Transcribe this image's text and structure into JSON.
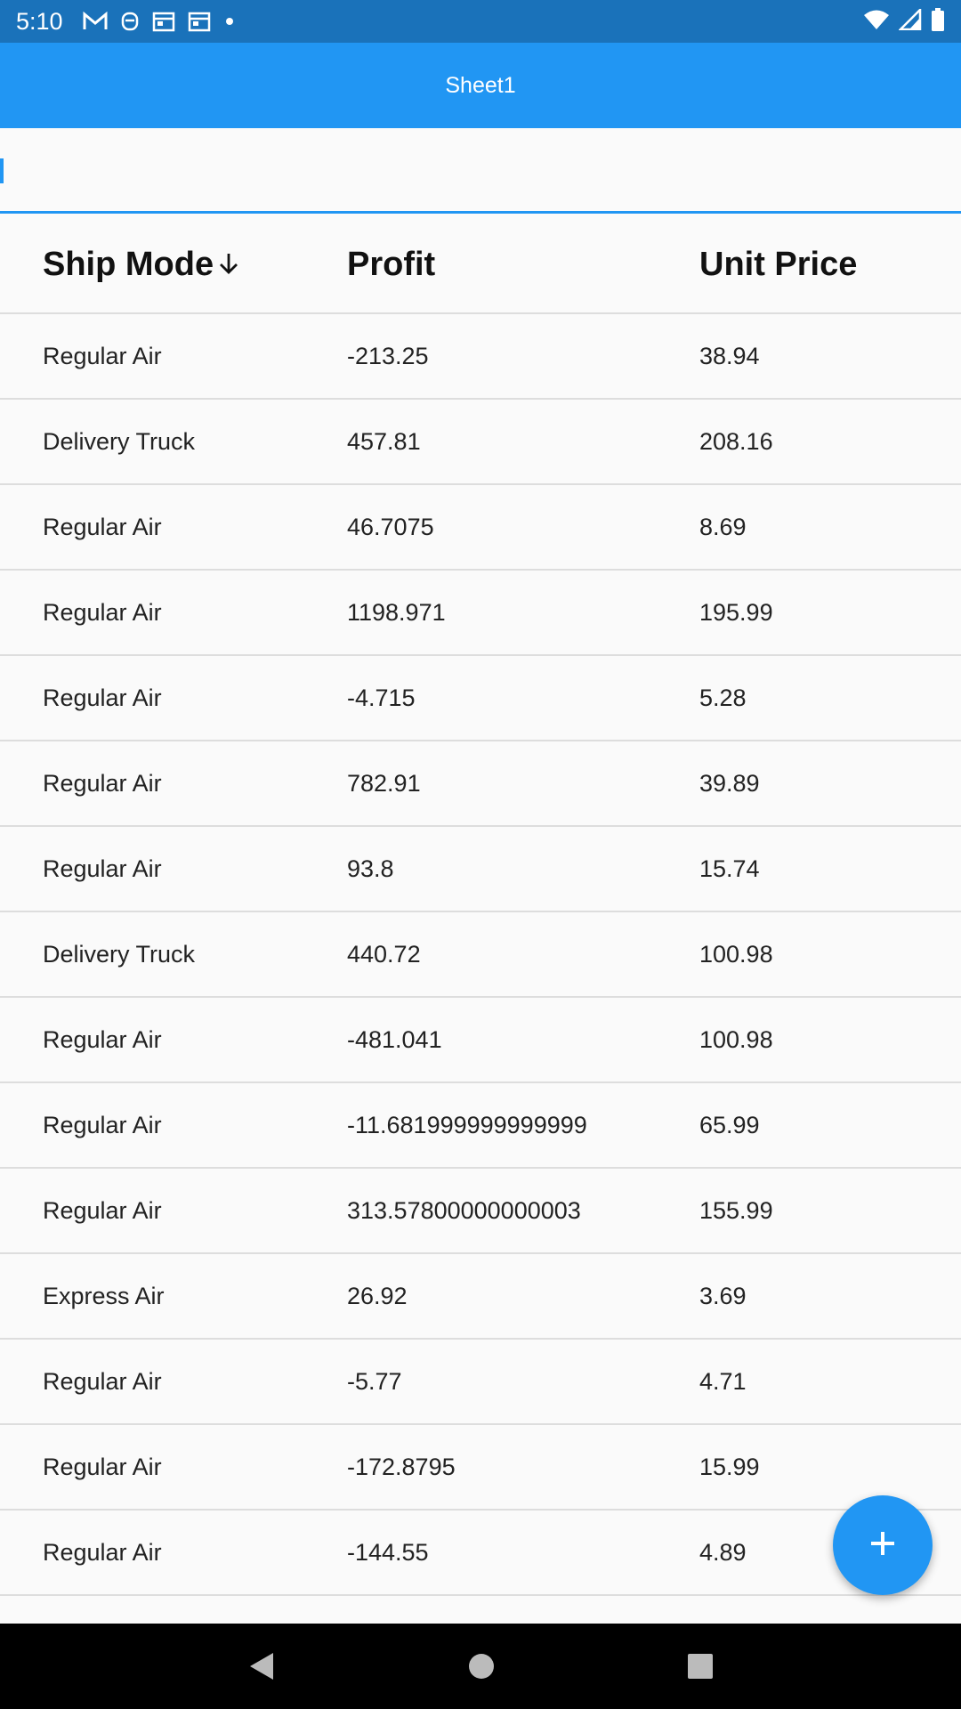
{
  "status_bar": {
    "time": "5:10",
    "left_icons": [
      "gmail-icon",
      "mask-icon",
      "calendar-icon",
      "calendar-icon",
      "dot-icon"
    ],
    "right_icons": [
      "wifi-icon",
      "signal-icon",
      "battery-icon"
    ]
  },
  "app_bar": {
    "title": "Sheet1"
  },
  "search": {
    "value": "",
    "placeholder": ""
  },
  "table": {
    "columns": [
      "Ship Mode",
      "Profit",
      "Unit Price"
    ],
    "sort_column": "Ship Mode",
    "sort_direction": "descending",
    "rows": [
      [
        "Regular Air",
        "-213.25",
        "38.94"
      ],
      [
        "Delivery Truck",
        "457.81",
        "208.16"
      ],
      [
        "Regular Air",
        "46.7075",
        "8.69"
      ],
      [
        "Regular Air",
        "1198.971",
        "195.99"
      ],
      [
        "Regular Air",
        "-4.715",
        "5.28"
      ],
      [
        "Regular Air",
        "782.91",
        "39.89"
      ],
      [
        "Regular Air",
        "93.8",
        "15.74"
      ],
      [
        "Delivery Truck",
        "440.72",
        "100.98"
      ],
      [
        "Regular Air",
        "-481.041",
        "100.98"
      ],
      [
        "Regular Air",
        "-11.681999999999999",
        "65.99"
      ],
      [
        "Regular Air",
        "313.57800000000003",
        "155.99"
      ],
      [
        "Express Air",
        "26.92",
        "3.69"
      ],
      [
        "Regular Air",
        "-5.77",
        "4.71"
      ],
      [
        "Regular Air",
        "-172.8795",
        "15.99"
      ],
      [
        "Regular Air",
        "-144.55",
        "4.89"
      ]
    ]
  },
  "fab": {
    "icon": "plus-icon"
  },
  "nav_bar": {
    "icons": [
      "back-icon",
      "home-icon",
      "recents-icon"
    ]
  },
  "colors": {
    "primary": "#2196f3",
    "status_bar": "#1a72ba",
    "divider": "#dddddd"
  }
}
